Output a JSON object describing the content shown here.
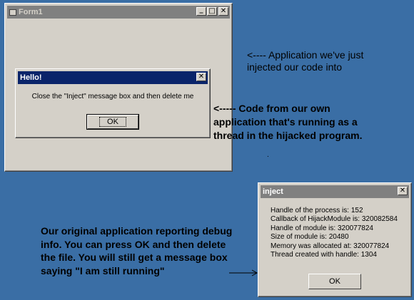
{
  "form1": {
    "title": "Form1",
    "controls": {
      "minimize": "_",
      "maximize": "□",
      "close": "✕"
    }
  },
  "hello_dialog": {
    "title": "Hello!",
    "message": "Close the \"Inject\" message box and then delete me",
    "ok_label": "OK",
    "close_glyph": "✕"
  },
  "inject_dialog": {
    "title": "inject",
    "close_glyph": "✕",
    "lines": [
      "Handle of the process is: 152",
      "Callback of HijackModule is: 320082584",
      "Handle of module is: 320077824",
      "Size of module is: 20480",
      "Memory was allocated at: 320077824",
      "Thread created with handle: 1304"
    ],
    "ok_label": "OK"
  },
  "annotations": {
    "app_note": [
      "<---- Application we've just",
      "injected our code into"
    ],
    "code_note": [
      "<----- Code from our own",
      "application that's running as a",
      "thread in the hijacked program."
    ],
    "debug_note": [
      "Our original application reporting debug",
      "info. You can press OK and then delete",
      "the file. You will still get a message box",
      "saying \"I am still running\""
    ],
    "dot": "."
  },
  "colors": {
    "desktop": "#3a6ea5",
    "active_title": "#0a246a",
    "inactive_title": "#808080",
    "window_face": "#d4d0c8"
  }
}
